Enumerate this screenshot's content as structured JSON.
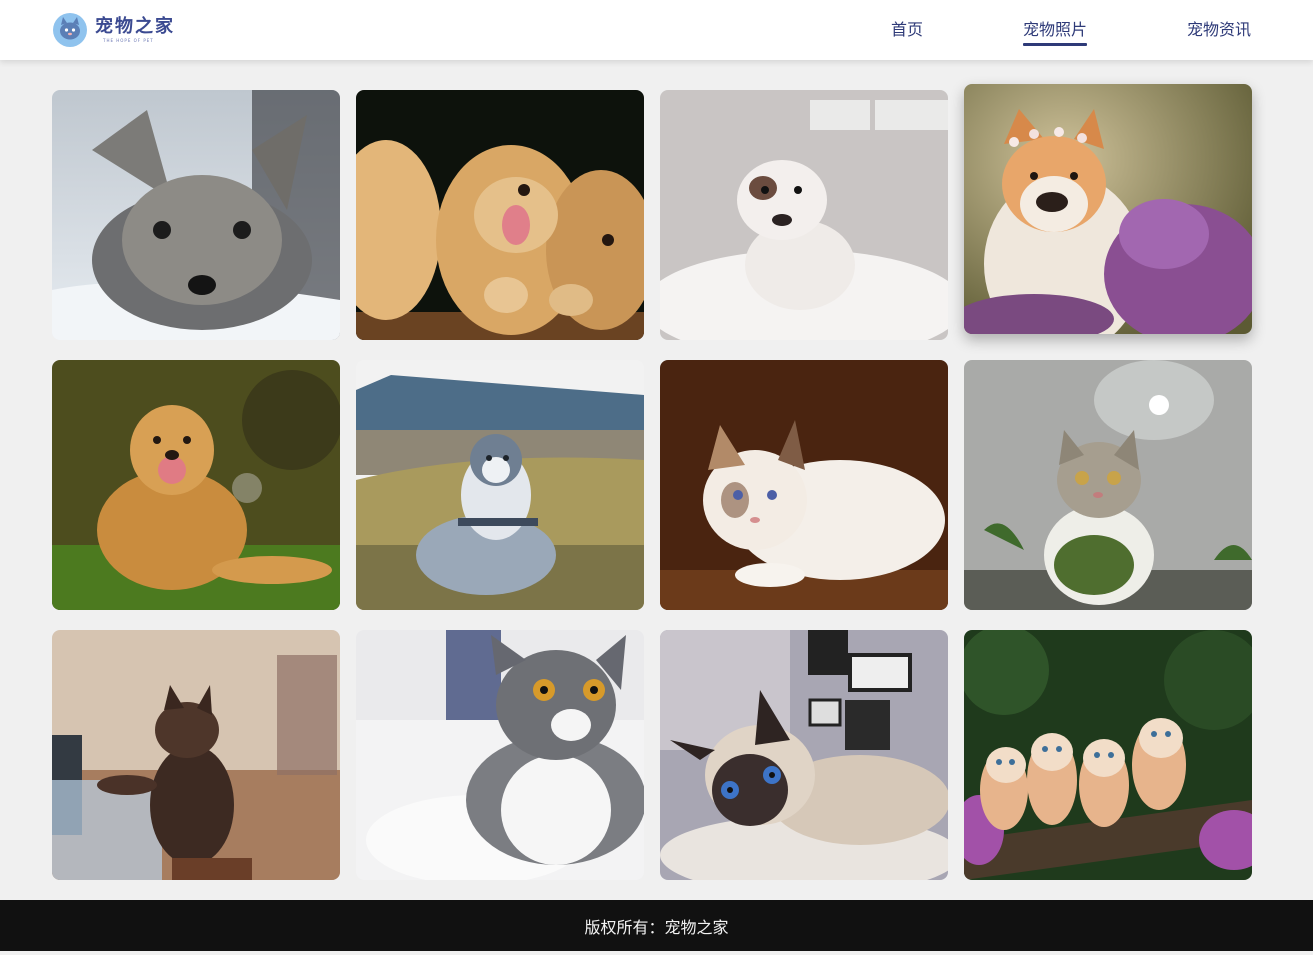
{
  "header": {
    "logo": {
      "title": "宠物之家",
      "subtitle": "THE HOPE OF PET"
    },
    "nav": [
      {
        "label": "首页",
        "active": false
      },
      {
        "label": "宠物照片",
        "active": true
      },
      {
        "label": "宠物资讯",
        "active": false
      }
    ]
  },
  "gallery": {
    "photos": [
      {
        "subject": "yorkie-puppy"
      },
      {
        "subject": "golden-retriever-puppies"
      },
      {
        "subject": "bulldog-puppy"
      },
      {
        "subject": "akita-flower-crown",
        "raised": true
      },
      {
        "subject": "golden-retriever-grass"
      },
      {
        "subject": "husky-field"
      },
      {
        "subject": "ragdoll-cat"
      },
      {
        "subject": "tabby-cat-scarf"
      },
      {
        "subject": "fluffy-kitten-piano"
      },
      {
        "subject": "british-shorthair-cat"
      },
      {
        "subject": "siamese-cat"
      },
      {
        "subject": "orange-kittens-branch"
      }
    ]
  },
  "footer": {
    "copyright": "版权所有：宠物之家"
  },
  "colors": {
    "accent": "#2e3a78",
    "background": "#f0f0f0",
    "footer": "#111111"
  }
}
